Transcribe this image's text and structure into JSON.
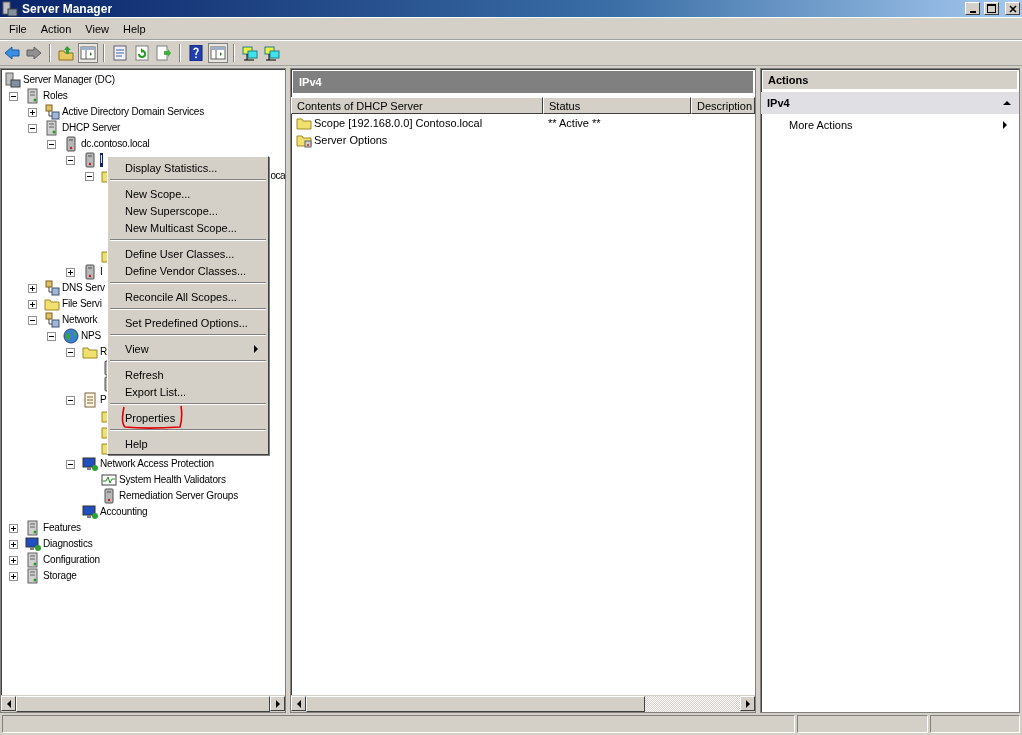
{
  "window": {
    "title": "Server Manager"
  },
  "menu_bar": [
    "File",
    "Action",
    "View",
    "Help"
  ],
  "toolbar": [
    {
      "kind": "back",
      "pressed": false
    },
    {
      "kind": "forward",
      "pressed": false
    },
    {
      "kind": "separator"
    },
    {
      "kind": "up",
      "pressed": false
    },
    {
      "kind": "pane",
      "pressed": true
    },
    {
      "kind": "separator"
    },
    {
      "kind": "properties",
      "pressed": false
    },
    {
      "kind": "refresh",
      "pressed": false
    },
    {
      "kind": "export",
      "pressed": false
    },
    {
      "kind": "separator"
    },
    {
      "kind": "help",
      "pressed": false
    },
    {
      "kind": "pane",
      "pressed": true
    },
    {
      "kind": "separator"
    },
    {
      "kind": "network",
      "pressed": false
    },
    {
      "kind": "network",
      "pressed": false
    }
  ],
  "tree": {
    "label": "Server Manager (DC)",
    "kind": "computer",
    "selected": false,
    "children": [
      {
        "label": "Roles",
        "kind": "server",
        "expanded": true,
        "selected": false,
        "children": [
          {
            "label": "Active Directory Domain Services",
            "kind": "network",
            "expanded": false,
            "selected": false
          },
          {
            "label": "DHCP Server",
            "kind": "server",
            "expanded": true,
            "selected": false,
            "children": [
              {
                "label": "dc.contoso.local",
                "kind": "tower",
                "expanded": true,
                "selected": false,
                "children": [
                  {
                    "label": "I",
                    "kind": "tower",
                    "expanded": true,
                    "selected": true,
                    "children": [
                      {
                        "label": "oca",
                        "kind": "folder",
                        "expanded": true,
                        "selected": false
                      },
                      {
                        "kind": "folder"
                      }
                    ]
                  },
                  {
                    "label": "I",
                    "kind": "tower",
                    "expanded": false,
                    "selected": false
                  }
                ]
              }
            ]
          },
          {
            "label": "DNS Serv",
            "kind": "network",
            "expanded": false,
            "selected": false
          },
          {
            "label": "File Servi",
            "kind": "folder",
            "expanded": false,
            "selected": false
          },
          {
            "label": "Network",
            "kind": "network",
            "expanded": true,
            "selected": false,
            "children": [
              {
                "label": "NPS",
                "kind": "globe",
                "expanded": true,
                "selected": false,
                "children": [
                  {
                    "label": "R",
                    "kind": "folder",
                    "expanded": true,
                    "selected": false,
                    "children": [
                      {
                        "kind": "tower"
                      },
                      {
                        "kind": "tower"
                      }
                    ]
                  },
                  {
                    "label": "P",
                    "kind": "document",
                    "expanded": true,
                    "selected": false,
                    "children": [
                      {
                        "kind": "folder"
                      },
                      {
                        "kind": "folder"
                      },
                      {
                        "kind": "folder"
                      }
                    ]
                  },
                  {
                    "label": "Network Access Protection",
                    "kind": "monitor",
                    "expanded": true,
                    "selected": false,
                    "children": [
                      {
                        "label": "System Health Validators",
                        "kind": "chart",
                        "selected": false
                      },
                      {
                        "label": "Remediation Server Groups",
                        "kind": "tower",
                        "selected": false
                      }
                    ]
                  },
                  {
                    "label": "Accounting",
                    "kind": "monitor",
                    "selected": false
                  }
                ]
              }
            ]
          }
        ]
      },
      {
        "label": "Features",
        "kind": "server",
        "expanded": false,
        "selected": false
      },
      {
        "label": "Diagnostics",
        "kind": "monitor",
        "expanded": false,
        "selected": false
      },
      {
        "label": "Configuration",
        "kind": "server",
        "expanded": false,
        "selected": false
      },
      {
        "label": "Storage",
        "kind": "server",
        "expanded": false,
        "selected": false
      }
    ]
  },
  "context_menu": [
    {
      "kind": "item",
      "label": "Display Statistics...",
      "submenu": false,
      "circled": false
    },
    {
      "kind": "separator"
    },
    {
      "kind": "item",
      "label": "New Scope...",
      "submenu": false,
      "circled": false
    },
    {
      "kind": "item",
      "label": "New Superscope...",
      "submenu": false,
      "circled": false
    },
    {
      "kind": "item",
      "label": "New Multicast Scope...",
      "submenu": false,
      "circled": false
    },
    {
      "kind": "separator"
    },
    {
      "kind": "item",
      "label": "Define User Classes...",
      "submenu": false,
      "circled": false
    },
    {
      "kind": "item",
      "label": "Define Vendor Classes...",
      "submenu": false,
      "circled": false
    },
    {
      "kind": "separator"
    },
    {
      "kind": "item",
      "label": "Reconcile All Scopes...",
      "submenu": false,
      "circled": false
    },
    {
      "kind": "separator"
    },
    {
      "kind": "item",
      "label": "Set Predefined Options...",
      "submenu": false,
      "circled": false
    },
    {
      "kind": "separator"
    },
    {
      "kind": "item",
      "label": "View",
      "submenu": true,
      "circled": false
    },
    {
      "kind": "separator"
    },
    {
      "kind": "item",
      "label": "Refresh",
      "submenu": false,
      "circled": false
    },
    {
      "kind": "item",
      "label": "Export List...",
      "submenu": false,
      "circled": false
    },
    {
      "kind": "separator"
    },
    {
      "kind": "item",
      "label": "Properties",
      "submenu": false,
      "circled": true
    },
    {
      "kind": "separator"
    },
    {
      "kind": "item",
      "label": "Help",
      "submenu": false,
      "circled": false
    }
  ],
  "content": {
    "title": "IPv4",
    "columns": [
      "Contents of DHCP Server",
      "Status",
      "Description"
    ],
    "rows": [
      {
        "kind": "folder",
        "cells": [
          "Scope [192.168.0.0] Contoso.local",
          "** Active **"
        ]
      },
      {
        "kind": "options",
        "cells": [
          "Server Options"
        ]
      }
    ]
  },
  "actions": {
    "title": "Actions",
    "section": {
      "title": "IPv4",
      "expanded": true
    },
    "items": [
      {
        "label": "More Actions",
        "submenu": true
      }
    ]
  }
}
